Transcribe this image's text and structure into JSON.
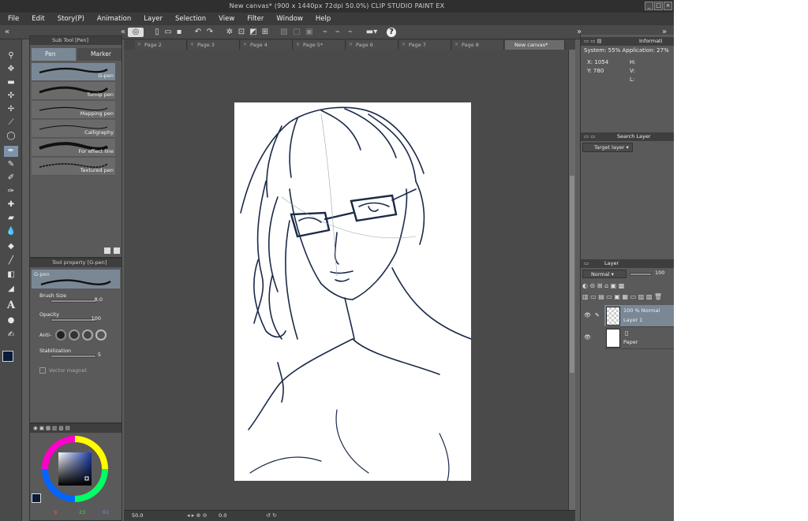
{
  "window": {
    "title": "New canvas* (900 x 1440px 72dpi 50.0%)    CLIP STUDIO PAINT EX",
    "minimize": "_",
    "maximize": "□",
    "close": "×"
  },
  "menu": [
    "File",
    "Edit",
    "Story(P)",
    "Animation",
    "Layer",
    "Selection",
    "View",
    "Filter",
    "Window",
    "Help"
  ],
  "sub_tool": {
    "header": "Sub Tool [Pen]",
    "tabs": [
      "Pen",
      "Marker"
    ],
    "brushes": [
      "G-pen",
      "Turnip pen",
      "Mapping pen",
      "Calligraphy",
      "For effect line",
      "Textured pen"
    ]
  },
  "tool_property": {
    "header": "Tool property [G-pen]",
    "brush_label": "G-pen",
    "brush_size_label": "Brush Size",
    "brush_size_value": "8.0",
    "opacity_label": "Opacity",
    "opacity_value": "100",
    "antialias_label": "Anti-",
    "stabilization_label": "Stabilization",
    "stabilization_value": "5",
    "vector_magnet_label": "Vector magnet"
  },
  "color": {
    "r": "9",
    "g": "23",
    "b": "61"
  },
  "doc_tabs": [
    "Page 2",
    "Page 3",
    "Page 4",
    "Page 5*",
    "Page 6",
    "Page 7",
    "Page 8",
    "New canvas*"
  ],
  "status": {
    "zoom": "50.0",
    "angle": "0.0"
  },
  "info": {
    "tab": "Informati",
    "system": "System: 55% Application: 27%",
    "x": "X: 1054",
    "y": "Y: 780",
    "h": "H:",
    "v": "V:",
    "l": "L:"
  },
  "search_layer": {
    "tab": "Search Layer",
    "target": "Target layer"
  },
  "layer_panel": {
    "tab": "Layer",
    "blend_mode": "Normal",
    "opacity": "100",
    "layers": [
      {
        "name": "Layer 1",
        "info": "100 % Normal"
      },
      {
        "name": "Paper",
        "info": ""
      }
    ]
  }
}
